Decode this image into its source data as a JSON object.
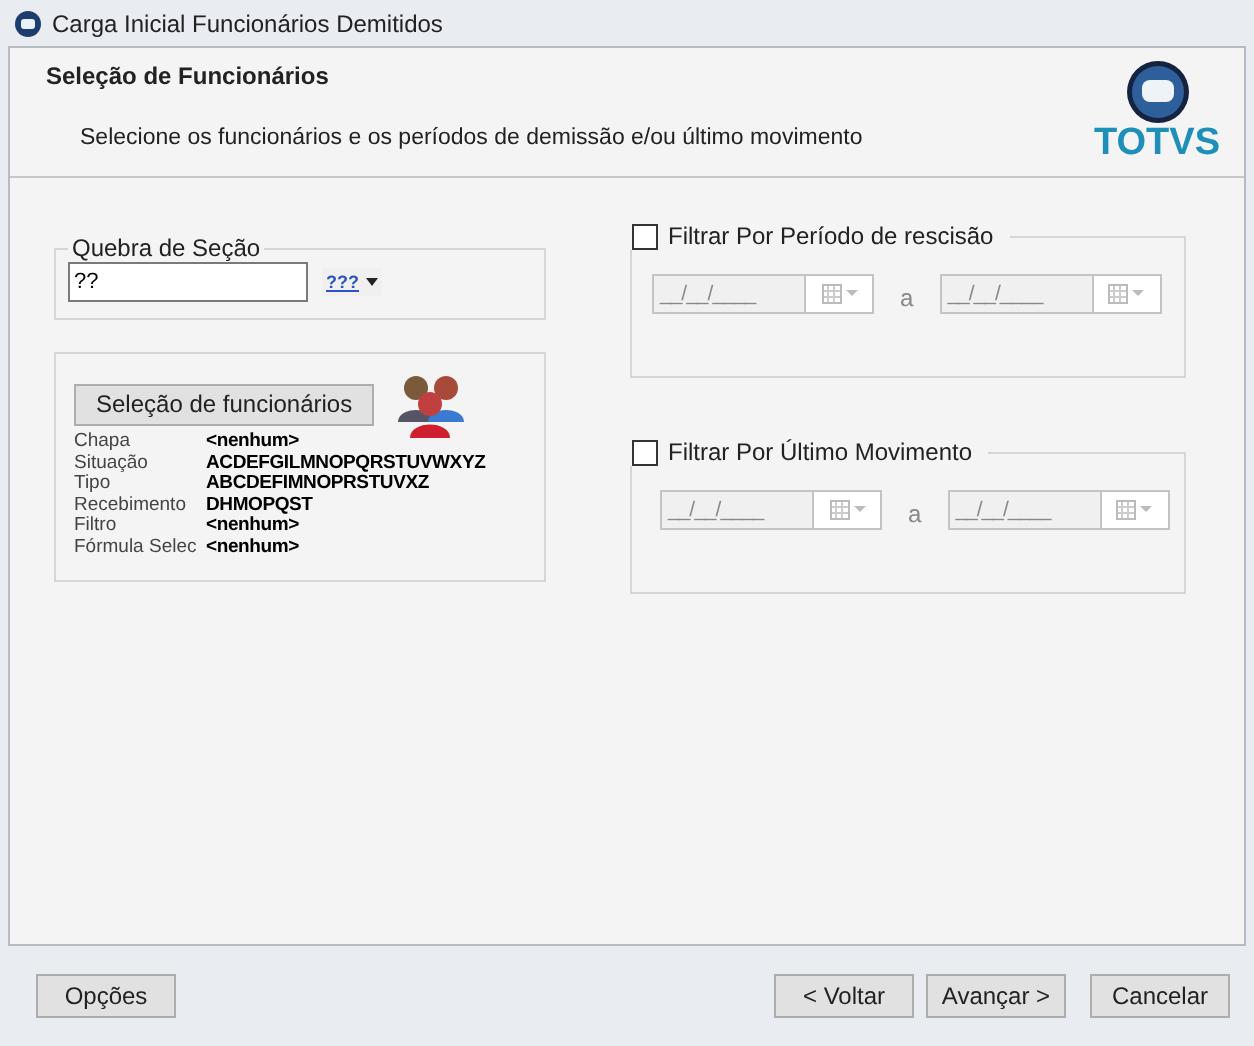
{
  "window": {
    "title": "Carga Inicial Funcionários Demitidos"
  },
  "header": {
    "title": "Seleção de Funcionários",
    "subtitle": "Selecione os funcionários e os períodos de demissão e/ou último movimento",
    "logo": "TOTVS"
  },
  "section_break": {
    "label": "Quebra de Seção",
    "value": "??",
    "button": "???"
  },
  "selection": {
    "button": "Seleção de funcionários",
    "fields": [
      {
        "label": "Chapa",
        "value": "<nenhum>"
      },
      {
        "label": "Situação",
        "value": "ACDEFGILMNOPQRSTUVWXYZ"
      },
      {
        "label": "Tipo",
        "value": "ABCDEFIMNOPRSTUVXZ"
      },
      {
        "label": "Recebimento",
        "value": "DHMOPQST"
      },
      {
        "label": "Filtro",
        "value": "<nenhum>"
      },
      {
        "label": "Fórmula Selec",
        "value": "<nenhum>"
      }
    ]
  },
  "filters": [
    {
      "label": "Filtrar Por Período de rescisão",
      "checked": false,
      "from": "__/__/____",
      "separator": "a",
      "to": "__/__/____"
    },
    {
      "label": "Filtrar Por Último Movimento",
      "checked": false,
      "from": "__/__/____",
      "separator": "a",
      "to": "__/__/____"
    }
  ],
  "buttons": {
    "options": "Opções",
    "back": "< Voltar",
    "next": "Avançar >",
    "cancel": "Cancelar"
  }
}
